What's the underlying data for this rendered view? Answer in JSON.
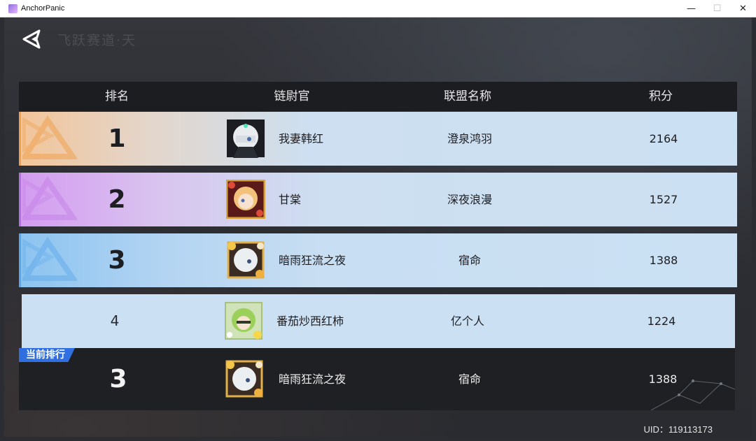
{
  "window": {
    "title": "AnchorPanic",
    "controls": {
      "minimize": "—",
      "maximize": "☐",
      "close": "✕"
    }
  },
  "header": {
    "back_icon": "back-arrow-icon",
    "title": "飞跃赛道·天"
  },
  "table": {
    "columns": [
      "排名",
      "链尉官",
      "联盟名称",
      "积分"
    ],
    "rows": [
      {
        "rank": "1",
        "name": "我妻韩红",
        "alliance": "澄泉鸿羽",
        "score": "2164",
        "accent": "#f0a04b",
        "avatar": "white-hair-masked-avatar"
      },
      {
        "rank": "2",
        "name": "甘棠",
        "alliance": "深夜浪漫",
        "score": "1527",
        "accent": "#b56ee0",
        "avatar": "blonde-red-frame-avatar"
      },
      {
        "rank": "3",
        "name": "暗雨狂流之夜",
        "alliance": "宿命",
        "score": "1388",
        "accent": "#5aa6ea",
        "avatar": "white-hair-gold-frame-avatar"
      },
      {
        "rank": "4",
        "name": "番茄炒西红柿",
        "alliance": "亿个人",
        "score": "1224",
        "accent": "",
        "avatar": "green-hair-flower-avatar"
      }
    ]
  },
  "current": {
    "tag": "当前排行",
    "rank": "3",
    "name": "暗雨狂流之夜",
    "alliance": "宿命",
    "score": "1388",
    "accent": "#2f6fe0"
  },
  "footer": {
    "uid": "UID：119113173"
  }
}
